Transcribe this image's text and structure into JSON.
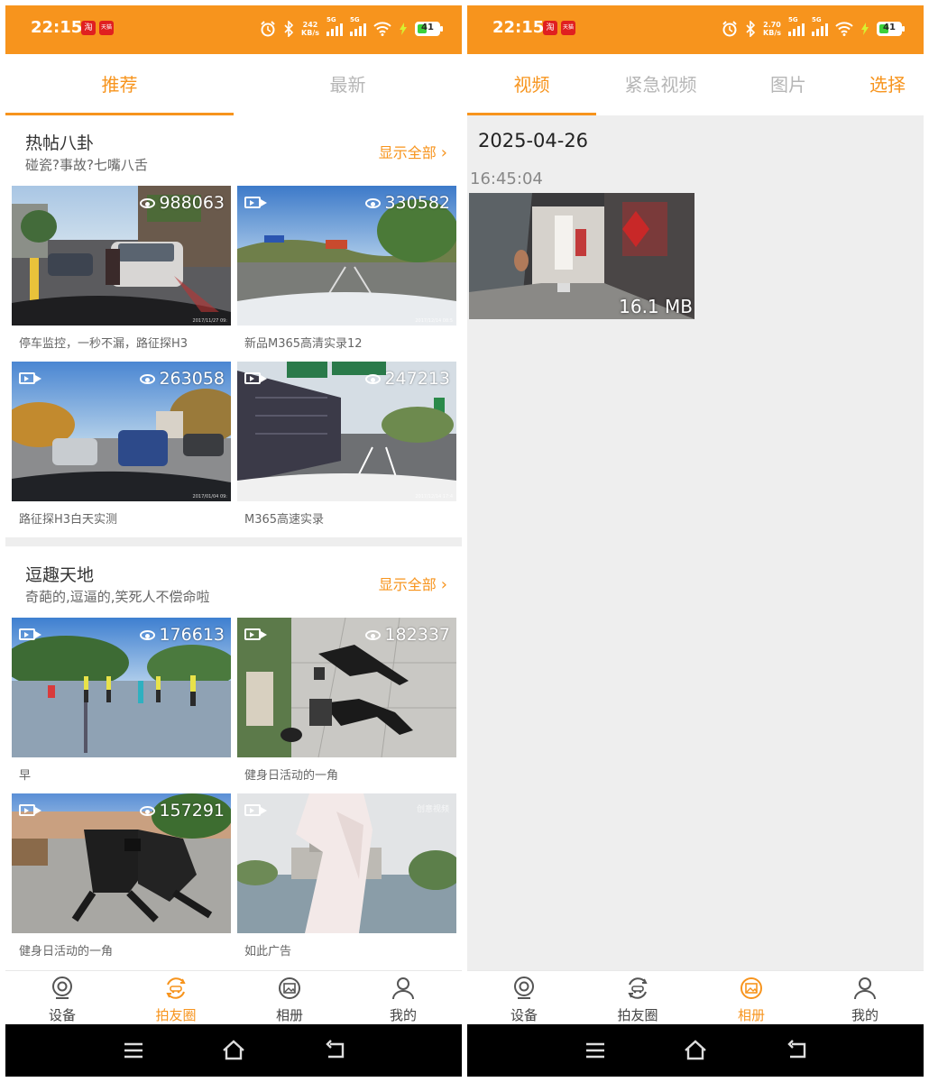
{
  "status_bar": {
    "time": "22:15",
    "left_badges": [
      "淘",
      "天猫"
    ],
    "net_speed_left": {
      "value": "242",
      "unit": "KB/s"
    },
    "net_speed_right": {
      "value": "2.70",
      "unit": "KB/s"
    },
    "signal_labels": [
      "5G",
      "5G"
    ],
    "battery": "41",
    "colors": {
      "bar": "#f7941d",
      "battery_fill": "#3bd13b"
    }
  },
  "left_screen": {
    "tabs": [
      {
        "label": "推荐",
        "active": true
      },
      {
        "label": "最新",
        "active": false
      }
    ],
    "sections": [
      {
        "title": "热帖八卦",
        "subtitle": "碰瓷?事故?七嘴八舌",
        "show_all": "显示全部",
        "cards": [
          {
            "views": "988063",
            "caption": "停车监控，一秒不漏，路征探H3",
            "stamp": "2017/11/27 09:",
            "video_icon": false
          },
          {
            "views": "330582",
            "caption": "新品M365高清实录12",
            "stamp": "2017/12/14 08:5",
            "video_icon": true
          },
          {
            "views": "263058",
            "caption": "路征探H3白天实测",
            "stamp": "2017/01/04 09:",
            "video_icon": true
          },
          {
            "views": "247213",
            "caption": "M365高速实录",
            "stamp": "2017/12/14 17:4",
            "video_icon": true
          }
        ]
      },
      {
        "title": "逗趣天地",
        "subtitle": "奇葩的,逗逼的,笑死人不偿命啦",
        "show_all": "显示全部",
        "cards": [
          {
            "views": "176613",
            "caption": "早",
            "video_icon": true
          },
          {
            "views": "182337",
            "caption": "健身日活动的一角",
            "video_icon": true
          },
          {
            "views": "157291",
            "caption": "健身日活动的一角",
            "video_icon": true
          },
          {
            "views": "",
            "caption": "如此广告",
            "tag": "创意视频",
            "video_icon": true
          }
        ]
      }
    ],
    "bottom_nav": [
      {
        "label": "设备",
        "icon": "camera-icon",
        "active": false
      },
      {
        "label": "拍友圈",
        "icon": "car-circle-icon",
        "active": true
      },
      {
        "label": "相册",
        "icon": "album-icon",
        "active": false
      },
      {
        "label": "我的",
        "icon": "person-icon",
        "active": false
      }
    ]
  },
  "right_screen": {
    "tabs": [
      {
        "label": "视频",
        "active": true
      },
      {
        "label": "紧急视频",
        "active": false
      },
      {
        "label": "图片",
        "active": false
      }
    ],
    "select_label": "选择",
    "date": "2025-04-26",
    "time": "16:45:04",
    "video_size": "16.1 MB",
    "bottom_nav": [
      {
        "label": "设备",
        "icon": "camera-icon",
        "active": false
      },
      {
        "label": "拍友圈",
        "icon": "car-circle-icon",
        "active": false
      },
      {
        "label": "相册",
        "icon": "album-icon",
        "active": true
      },
      {
        "label": "我的",
        "icon": "person-icon",
        "active": false
      }
    ]
  },
  "system_nav": [
    "menu-icon",
    "home-icon",
    "back-icon"
  ],
  "accent_color": "#f7941d"
}
